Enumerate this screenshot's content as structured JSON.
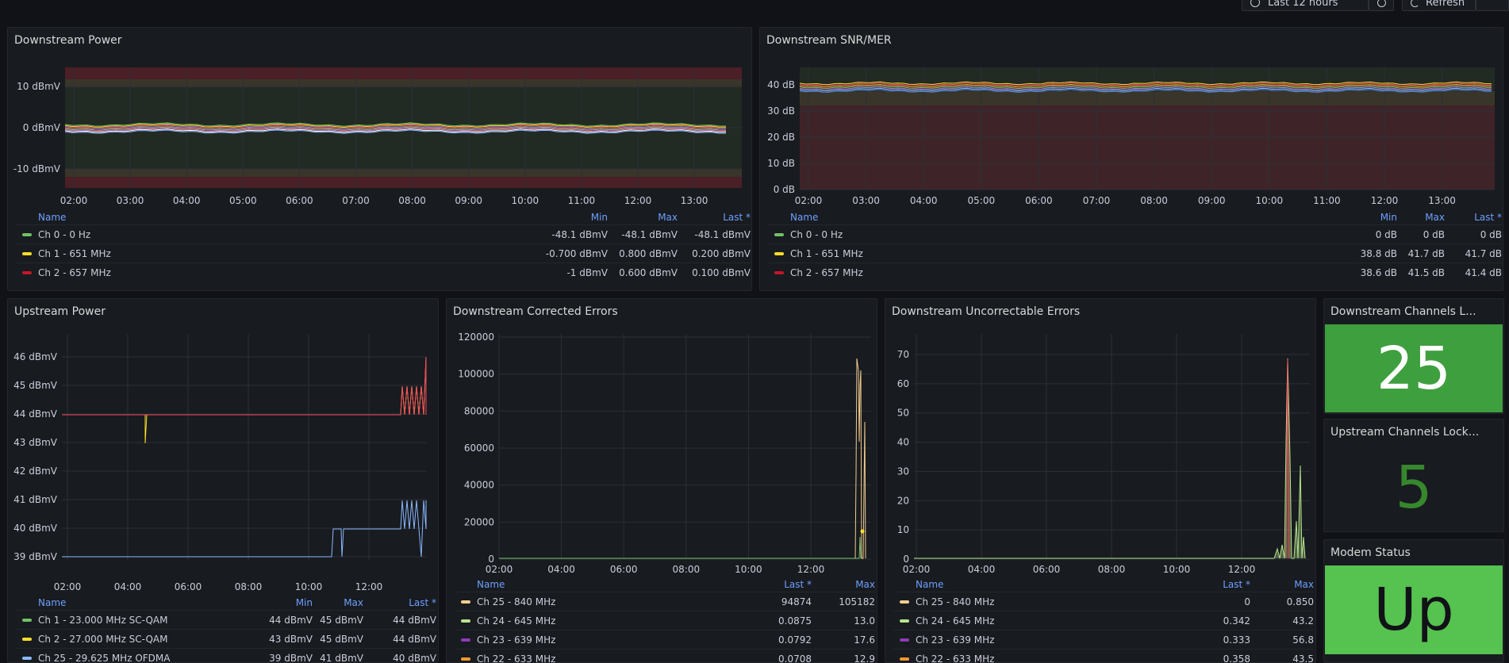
{
  "toolbar": {
    "time_range": "Last 12 hours",
    "refresh": "Refresh"
  },
  "panels": {
    "ds_power": {
      "title": "Downstream Power",
      "y_ticks": [
        "10 dBmV",
        "0 dBmV",
        "-10 dBmV"
      ],
      "x_ticks": [
        "02:00",
        "03:00",
        "04:00",
        "05:00",
        "06:00",
        "07:00",
        "08:00",
        "09:00",
        "10:00",
        "11:00",
        "12:00",
        "13:00"
      ],
      "legend_header": {
        "name": "Name",
        "min": "Min",
        "max": "Max",
        "last": "Last *"
      },
      "legend_rows": [
        {
          "name": "Ch 0 - 0 Hz",
          "color": "#73bf69",
          "min": "-48.1 dBmV",
          "max": "-48.1 dBmV",
          "last": "-48.1 dBmV"
        },
        {
          "name": "Ch 1 - 651 MHz",
          "color": "#fade2a",
          "min": "-0.700 dBmV",
          "max": "0.800 dBmV",
          "last": "0.200 dBmV"
        },
        {
          "name": "Ch 2 - 657 MHz",
          "color": "#c4162a",
          "min": "-1 dBmV",
          "max": "0.600 dBmV",
          "last": "0.100 dBmV"
        }
      ]
    },
    "ds_snr": {
      "title": "Downstream SNR/MER",
      "y_ticks": [
        "40 dB",
        "30 dB",
        "20 dB",
        "10 dB",
        "0 dB"
      ],
      "x_ticks": [
        "02:00",
        "03:00",
        "04:00",
        "05:00",
        "06:00",
        "07:00",
        "08:00",
        "09:00",
        "10:00",
        "11:00",
        "12:00",
        "13:00"
      ],
      "legend_header": {
        "name": "Name",
        "min": "Min",
        "max": "Max",
        "last": "Last *"
      },
      "legend_rows": [
        {
          "name": "Ch 0 - 0 Hz",
          "color": "#73bf69",
          "min": "0 dB",
          "max": "0 dB",
          "last": "0 dB"
        },
        {
          "name": "Ch 1 - 651 MHz",
          "color": "#fade2a",
          "min": "38.8 dB",
          "max": "41.7 dB",
          "last": "41.7 dB"
        },
        {
          "name": "Ch 2 - 657 MHz",
          "color": "#c4162a",
          "min": "38.6 dB",
          "max": "41.5 dB",
          "last": "41.4 dB"
        }
      ]
    },
    "us_power": {
      "title": "Upstream Power",
      "y_ticks": [
        "46 dBmV",
        "45 dBmV",
        "44 dBmV",
        "43 dBmV",
        "42 dBmV",
        "41 dBmV",
        "40 dBmV",
        "39 dBmV"
      ],
      "x_ticks": [
        "02:00",
        "04:00",
        "06:00",
        "08:00",
        "10:00",
        "12:00"
      ],
      "legend_header": {
        "name": "Name",
        "min": "Min",
        "max": "Max",
        "last": "Last *"
      },
      "legend_rows": [
        {
          "name": "Ch 1 - 23.000 MHz SC-QAM",
          "color": "#73bf69",
          "min": "44 dBmV",
          "max": "45 dBmV",
          "last": "44 dBmV"
        },
        {
          "name": "Ch 2 - 27.000 MHz SC-QAM",
          "color": "#fade2a",
          "min": "43 dBmV",
          "max": "45 dBmV",
          "last": "44 dBmV"
        },
        {
          "name": "Ch 25 - 29.625 MHz OFDMA",
          "color": "#8ab8ff",
          "min": "39 dBmV",
          "max": "41 dBmV",
          "last": "40 dBmV"
        }
      ]
    },
    "ds_corrected": {
      "title": "Downstream Corrected Errors",
      "y_ticks": [
        "120000",
        "100000",
        "80000",
        "60000",
        "40000",
        "20000",
        "0"
      ],
      "x_ticks": [
        "02:00",
        "04:00",
        "06:00",
        "08:00",
        "10:00",
        "12:00"
      ],
      "legend_header": {
        "name": "Name",
        "last": "Last *",
        "max": "Max"
      },
      "legend_rows": [
        {
          "name": "Ch 25 - 840 MHz",
          "color": "#f2cc8f",
          "last": "94874",
          "max": "105182"
        },
        {
          "name": "Ch 24 - 645 MHz",
          "color": "#b5e48c",
          "last": "0.0875",
          "max": "13.0"
        },
        {
          "name": "Ch 23 - 639 MHz",
          "color": "#8f3bb8",
          "last": "0.0792",
          "max": "17.6"
        },
        {
          "name": "Ch 22 - 633 MHz",
          "color": "#ff9830",
          "last": "0.0708",
          "max": "12.9"
        }
      ]
    },
    "ds_uncorrectable": {
      "title": "Downstream Uncorrectable Errors",
      "y_ticks": [
        "70",
        "60",
        "50",
        "40",
        "30",
        "20",
        "10",
        "0"
      ],
      "x_ticks": [
        "02:00",
        "04:00",
        "06:00",
        "08:00",
        "10:00",
        "12:00"
      ],
      "legend_header": {
        "name": "Name",
        "last": "Last *",
        "max": "Max"
      },
      "legend_rows": [
        {
          "name": "Ch 25 - 840 MHz",
          "color": "#f2cc8f",
          "last": "0",
          "max": "0.850"
        },
        {
          "name": "Ch 24 - 645 MHz",
          "color": "#b5e48c",
          "last": "0.342",
          "max": "43.2"
        },
        {
          "name": "Ch 23 - 639 MHz",
          "color": "#8f3bb8",
          "last": "0.333",
          "max": "56.8"
        },
        {
          "name": "Ch 22 - 633 MHz",
          "color": "#ff9830",
          "last": "0.358",
          "max": "43.5"
        }
      ]
    },
    "ds_locked": {
      "title": "Downstream Channels L...",
      "value": "25",
      "bg": "#3e9f3e",
      "fg": "#ffffff"
    },
    "us_locked": {
      "title": "Upstream Channels Lock...",
      "value": "5",
      "fg": "#37872d"
    },
    "modem": {
      "title": "Modem Status",
      "value": "Up",
      "bg": "#56c24f",
      "fg": "#111217"
    }
  }
}
